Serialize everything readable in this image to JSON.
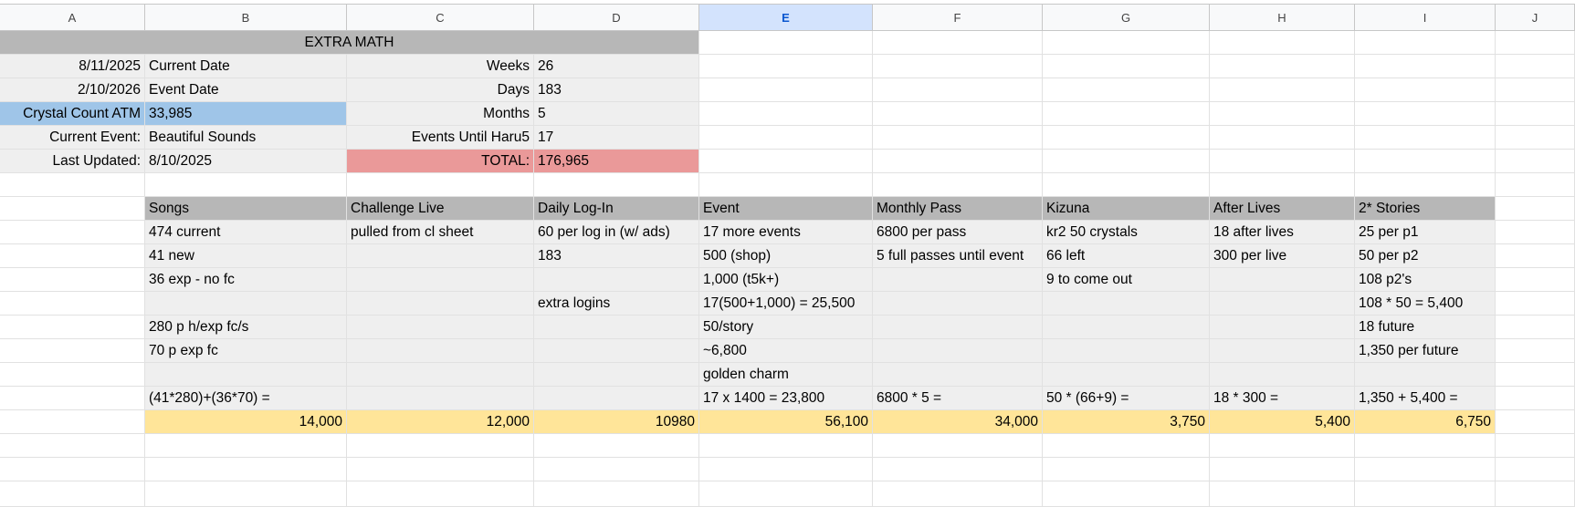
{
  "columns": [
    "A",
    "B",
    "C",
    "D",
    "E",
    "F",
    "G",
    "H",
    "I",
    "J"
  ],
  "selected_column": "E",
  "summary": {
    "title": "EXTRA MATH",
    "current_date_value": "8/11/2025",
    "current_date_label": "Current Date",
    "event_date_value": "2/10/2026",
    "event_date_label": "Event Date",
    "crystal_label": "Crystal Count ATM",
    "crystal_value": "33,985",
    "current_event_label": "Current Event:",
    "current_event_value": "Beautiful Sounds",
    "last_updated_label": "Last Updated:",
    "last_updated_value": "8/10/2025",
    "weeks_label": "Weeks",
    "weeks_value": "26",
    "days_label": "Days",
    "days_value": "183",
    "months_label": "Months",
    "months_value": "5",
    "events_until_label": "Events Until Haru5",
    "events_until_value": "17",
    "total_label": "TOTAL:",
    "total_value": "176,965"
  },
  "table": {
    "headers": [
      "Songs",
      "Challenge Live",
      "Daily Log-In",
      "Event",
      "Monthly Pass",
      "Kizuna",
      "After Lives",
      "2* Stories"
    ],
    "rows": [
      [
        "474 current",
        "pulled from cl sheet",
        "60 per log in (w/ ads)",
        "17 more events",
        "6800 per pass",
        "kr2 50 crystals",
        "18 after lives",
        "25 per p1"
      ],
      [
        "41 new",
        "",
        "183",
        "500 (shop)",
        "5 full passes until event",
        "66 left",
        "300 per live",
        "50 per p2"
      ],
      [
        "36 exp - no fc",
        "",
        "",
        "1,000 (t5k+)",
        "",
        "9 to come out",
        "",
        "108 p2's"
      ],
      [
        "",
        "",
        "extra logins",
        "17(500+1,000) = 25,500",
        "",
        "",
        "",
        "108 * 50 = 5,400"
      ],
      [
        "280 p h/exp fc/s",
        "",
        "",
        "50/story",
        "",
        "",
        "",
        "18 future"
      ],
      [
        "70 p exp fc",
        "",
        "",
        "~6,800",
        "",
        "",
        "",
        "1,350 per future"
      ],
      [
        "",
        "",
        "",
        "golden charm",
        "",
        "",
        "",
        ""
      ],
      [
        "(41*280)+(36*70) =",
        "",
        "",
        "17 x 1400 = 23,800",
        "6800 * 5 =",
        "50 * (66+9) =",
        "18 * 300 =",
        "1,350 + 5,400 ="
      ]
    ],
    "totals": [
      "14,000",
      "12,000",
      "10980",
      "56,100",
      "34,000",
      "3,750",
      "5,400",
      "6,750"
    ]
  }
}
